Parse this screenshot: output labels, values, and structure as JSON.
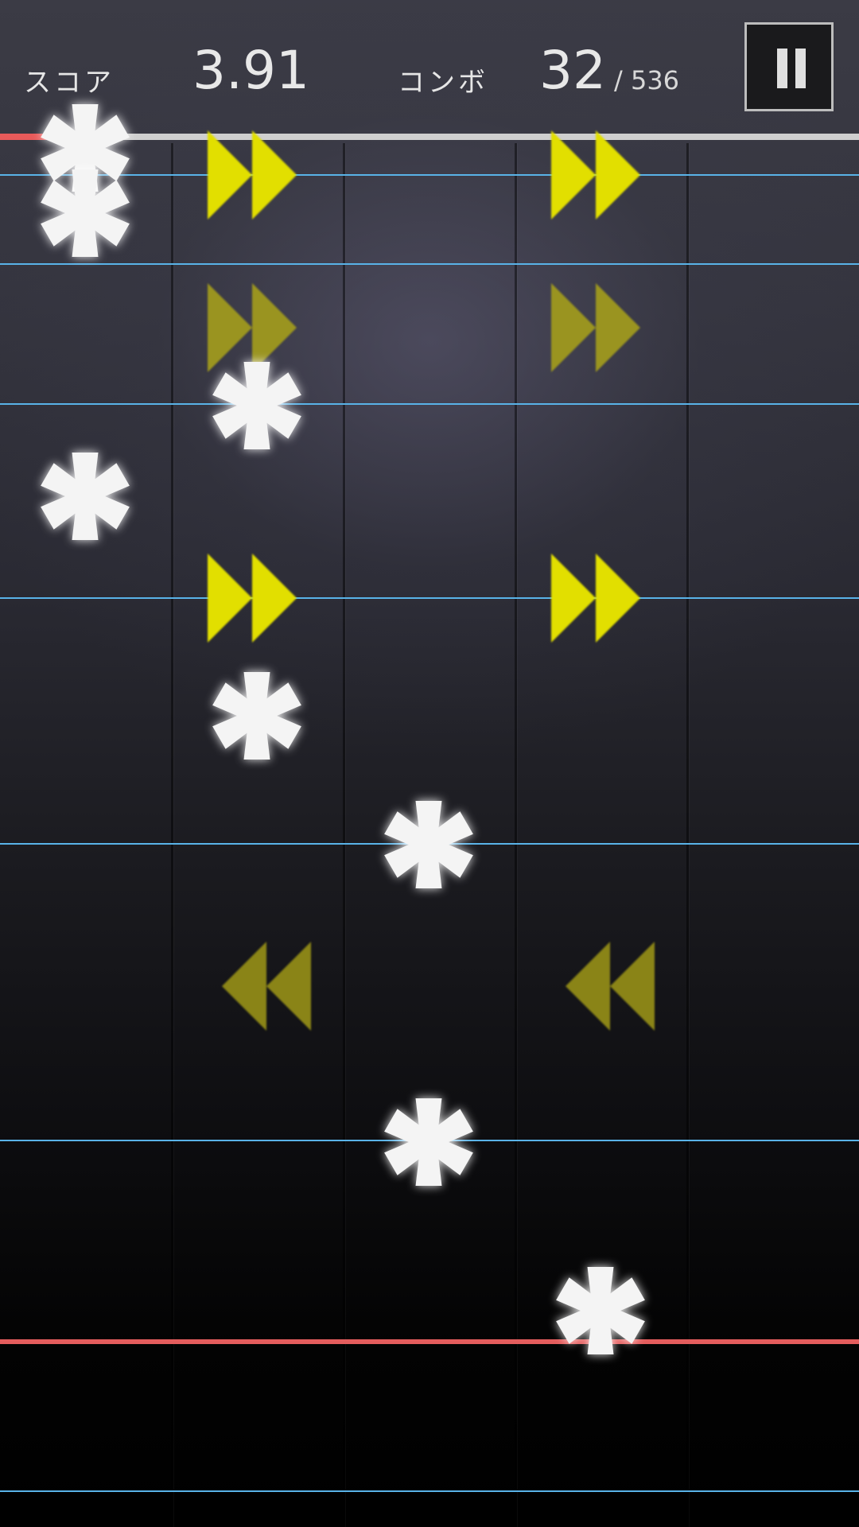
{
  "hud": {
    "score_label": "スコア",
    "score_value": "3.91",
    "combo_label": "コンボ",
    "combo_value": "32",
    "combo_total": "/ 536",
    "pause_icon": "pause-icon"
  },
  "progress": {
    "fraction": 0.06,
    "fill_color": "#e85a5a",
    "track_color": "#cfcfcf"
  },
  "playfield": {
    "lane_count": 5,
    "beat_line_color": "#59b3e8",
    "judgement_line_color": "#e45d5d"
  },
  "notes": [
    {
      "type": "tap",
      "lane": 1,
      "icon": "asterisk-icon"
    },
    {
      "type": "tap",
      "lane": 1,
      "icon": "asterisk-icon"
    },
    {
      "type": "flick-right",
      "lane": 2,
      "icon": "double-arrow-right-icon"
    },
    {
      "type": "flick-right",
      "lane": 4,
      "icon": "double-arrow-right-icon"
    },
    {
      "type": "flick-right",
      "lane": 2,
      "icon": "double-arrow-right-icon",
      "dim": true
    },
    {
      "type": "flick-right",
      "lane": 4,
      "icon": "double-arrow-right-icon",
      "dim": true
    },
    {
      "type": "tap",
      "lane": 2,
      "icon": "asterisk-icon"
    },
    {
      "type": "tap",
      "lane": 1,
      "icon": "asterisk-icon"
    },
    {
      "type": "flick-right",
      "lane": 2,
      "icon": "double-arrow-right-icon"
    },
    {
      "type": "flick-right",
      "lane": 4,
      "icon": "double-arrow-right-icon"
    },
    {
      "type": "tap",
      "lane": 2,
      "icon": "asterisk-icon"
    },
    {
      "type": "tap",
      "lane": 3,
      "icon": "asterisk-icon"
    },
    {
      "type": "flick-left",
      "lane": 2,
      "icon": "double-arrow-left-icon",
      "dim": true
    },
    {
      "type": "flick-left",
      "lane": 4,
      "icon": "double-arrow-left-icon",
      "dim": true
    },
    {
      "type": "tap",
      "lane": 3,
      "icon": "asterisk-icon"
    },
    {
      "type": "tap",
      "lane": 4,
      "icon": "asterisk-icon"
    }
  ]
}
